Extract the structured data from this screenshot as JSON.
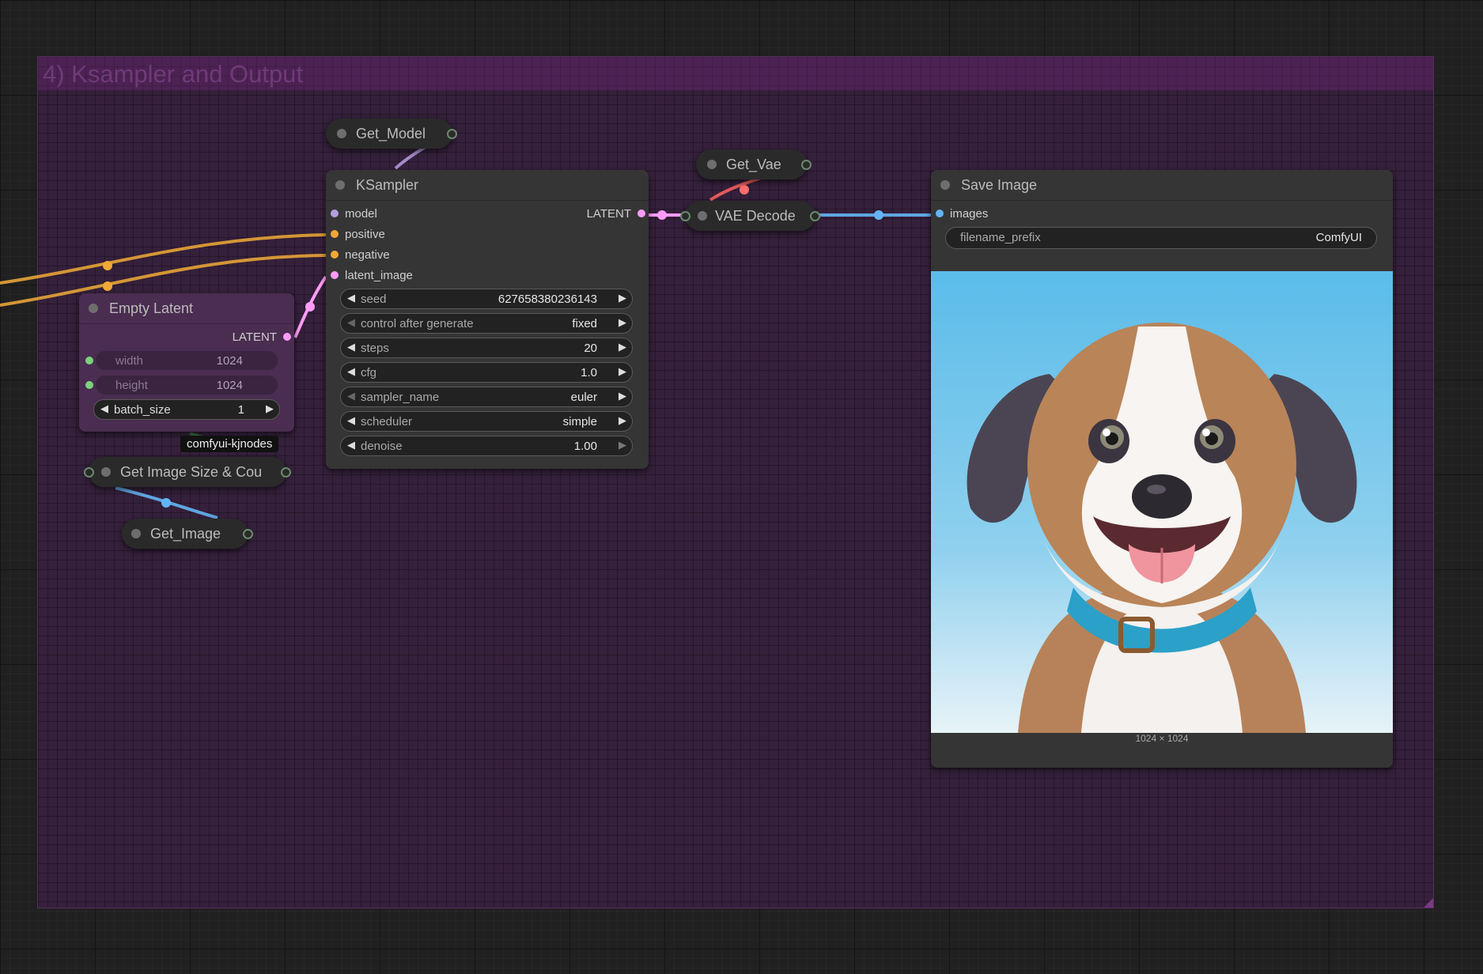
{
  "group": {
    "title": "4) Ksampler and Output"
  },
  "nodes": {
    "get_model": {
      "title": "Get_Model"
    },
    "get_vae": {
      "title": "Get_Vae"
    },
    "ksampler": {
      "title": "KSampler",
      "inputs": [
        "model",
        "positive",
        "negative",
        "latent_image"
      ],
      "output": "LATENT",
      "widgets": [
        {
          "label": "seed",
          "value": "627658380236143"
        },
        {
          "label": "control after generate",
          "value": "fixed"
        },
        {
          "label": "steps",
          "value": "20"
        },
        {
          "label": "cfg",
          "value": "1.0"
        },
        {
          "label": "sampler_name",
          "value": "euler"
        },
        {
          "label": "scheduler",
          "value": "simple"
        },
        {
          "label": "denoise",
          "value": "1.00"
        }
      ]
    },
    "vae_decode": {
      "title": "VAE Decode"
    },
    "save_image": {
      "title": "Save Image",
      "input": "images",
      "filename_prefix_label": "filename_prefix",
      "filename_prefix_value": "ComfyUI",
      "image_size": "1024 × 1024"
    },
    "empty_latent": {
      "title": "Empty Latent",
      "output": "LATENT",
      "width_label": "width",
      "width_value": "1024",
      "height_label": "height",
      "height_value": "1024",
      "batch_label": "batch_size",
      "batch_value": "1"
    },
    "tooltip": "comfyui-kjnodes",
    "get_image_size": {
      "title": "Get Image Size & Cou"
    },
    "get_image": {
      "title": "Get_Image"
    }
  },
  "colors": {
    "group_bg": "#35203b",
    "model": "#b39ddb",
    "conditioning": "#f0a836",
    "latent": "#ff9cf9",
    "image": "#64b5f6",
    "vae": "#ff6e6e",
    "int": "#7bd47b"
  }
}
